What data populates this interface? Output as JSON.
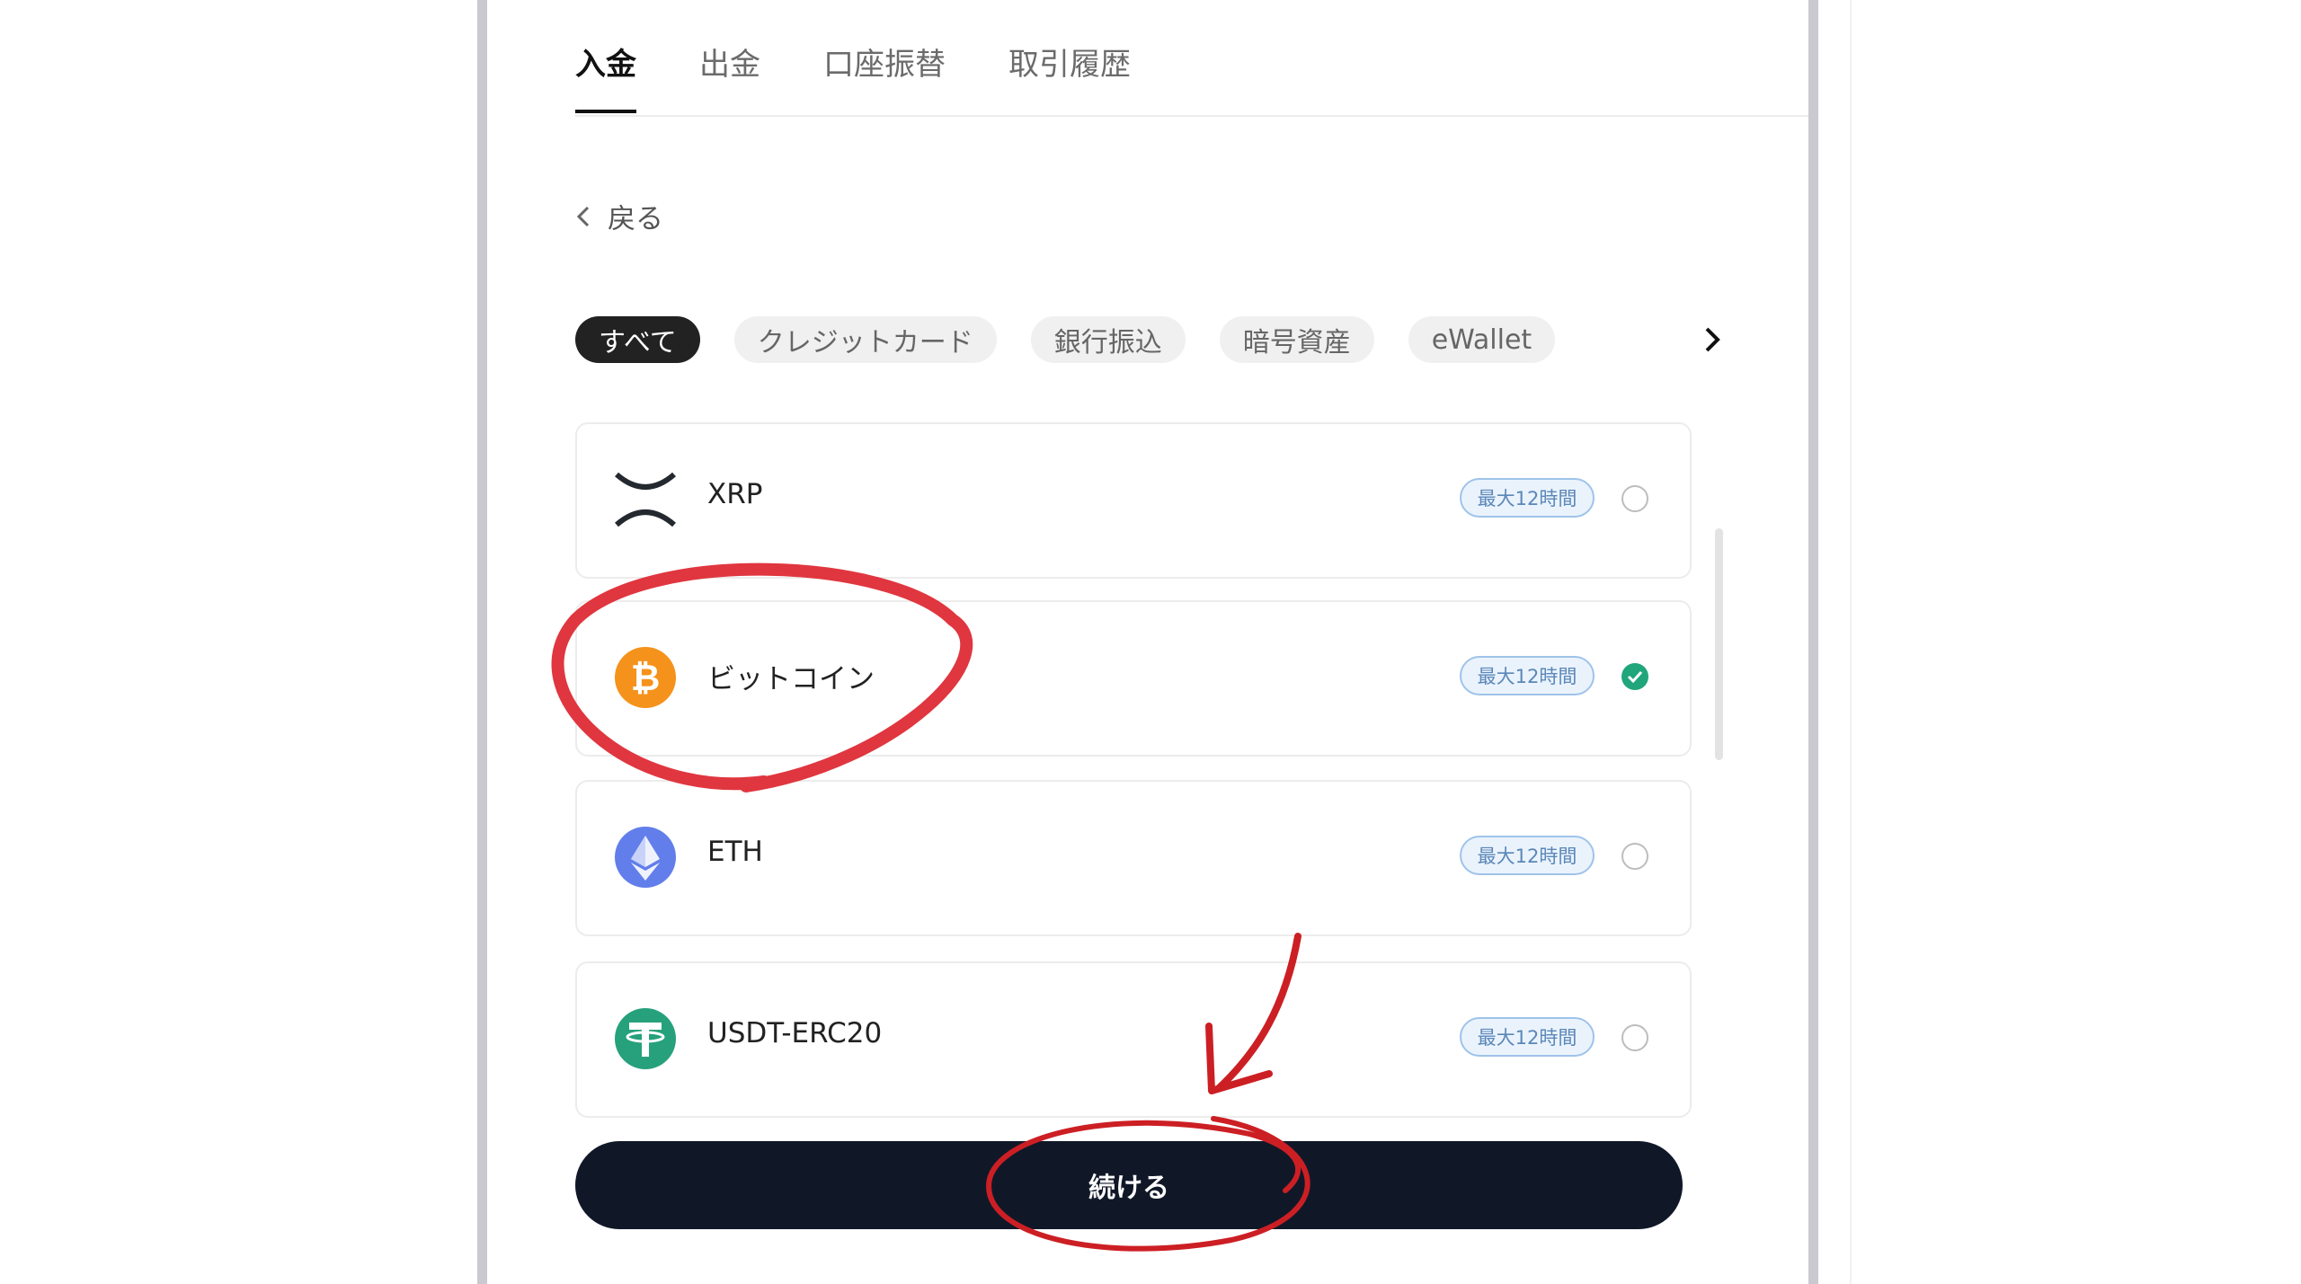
{
  "tabs": [
    {
      "label": "入金",
      "active": true
    },
    {
      "label": "出金",
      "active": false
    },
    {
      "label": "口座振替",
      "active": false
    },
    {
      "label": "取引履歴",
      "active": false
    }
  ],
  "back": {
    "label": "戻る"
  },
  "filters": [
    {
      "label": "すべて",
      "active": true
    },
    {
      "label": "クレジットカード",
      "active": false
    },
    {
      "label": "銀行振込",
      "active": false
    },
    {
      "label": "暗号資産",
      "active": false
    },
    {
      "label": "eWallet",
      "active": false
    }
  ],
  "methods": [
    {
      "name": "XRP",
      "badge": "最大12時間",
      "selected": false,
      "icon": "xrp-icon"
    },
    {
      "name": "ビットコイン",
      "badge": "最大12時間",
      "selected": true,
      "icon": "bitcoin-icon"
    },
    {
      "name": "ETH",
      "badge": "最大12時間",
      "selected": false,
      "icon": "ethereum-icon"
    },
    {
      "name": "USDT-ERC20",
      "badge": "最大12時間",
      "selected": false,
      "icon": "tether-icon"
    }
  ],
  "continue_button": {
    "label": "続ける"
  },
  "colors": {
    "accent_dark": "#101828",
    "selected_green": "#20a67a",
    "annotation_red": "#e0363f",
    "bitcoin_orange": "#f5921b",
    "ethereum_blue": "#627eea",
    "tether_green": "#26a17b"
  }
}
